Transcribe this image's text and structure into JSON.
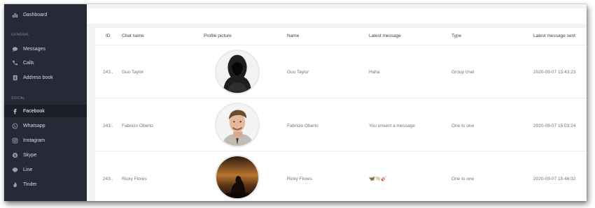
{
  "sidebar": {
    "top_item": {
      "label": "Dashboard",
      "icon": "dashboard-icon"
    },
    "sections": [
      {
        "title": "GENERAL",
        "items": [
          {
            "label": "Messages",
            "icon": "message-icon"
          },
          {
            "label": "Calls",
            "icon": "phone-icon"
          },
          {
            "label": "Address book",
            "icon": "address-book-icon"
          }
        ]
      },
      {
        "title": "SOCIAL",
        "items": [
          {
            "label": "Facebook",
            "icon": "facebook-icon",
            "active": true
          },
          {
            "label": "Whatsapp",
            "icon": "whatsapp-icon"
          },
          {
            "label": "Instagram",
            "icon": "instagram-icon"
          },
          {
            "label": "Skype",
            "icon": "skype-icon"
          },
          {
            "label": "Line",
            "icon": "line-icon"
          },
          {
            "label": "Tinder",
            "icon": "tinder-icon"
          }
        ]
      }
    ]
  },
  "table": {
    "headers": [
      "ID",
      "Chat name",
      "Profile picture",
      "Name",
      "Latest message",
      "Type",
      "Latest message sent"
    ],
    "rows": [
      {
        "id": "243..",
        "chat_name": "Guo Taylor",
        "picture": "hooded-figure",
        "name": "Guo Taylor",
        "latest_message": "Haha",
        "type": "Group chat",
        "sent": "2020-09-07 15:43:23"
      },
      {
        "id": "243..",
        "chat_name": "Fabricio Oberto",
        "picture": "smiling-man",
        "name": "Fabricio Oberto",
        "latest_message": "You unsent a message",
        "type": "One to one",
        "sent": "2020-09-07 15:03:24"
      },
      {
        "id": "243..",
        "chat_name": "Ricky Flores",
        "picture": "sunset-silhouette",
        "name": "Ricky Flores",
        "latest_message": "🦋🐚🎸",
        "type": "One to one",
        "sent": "2020-09-07 15:46:32"
      }
    ]
  },
  "colors": {
    "sidebar_bg": "#252a36",
    "sidebar_active": "#1b1f29",
    "page_bg": "#f1f2f4"
  }
}
